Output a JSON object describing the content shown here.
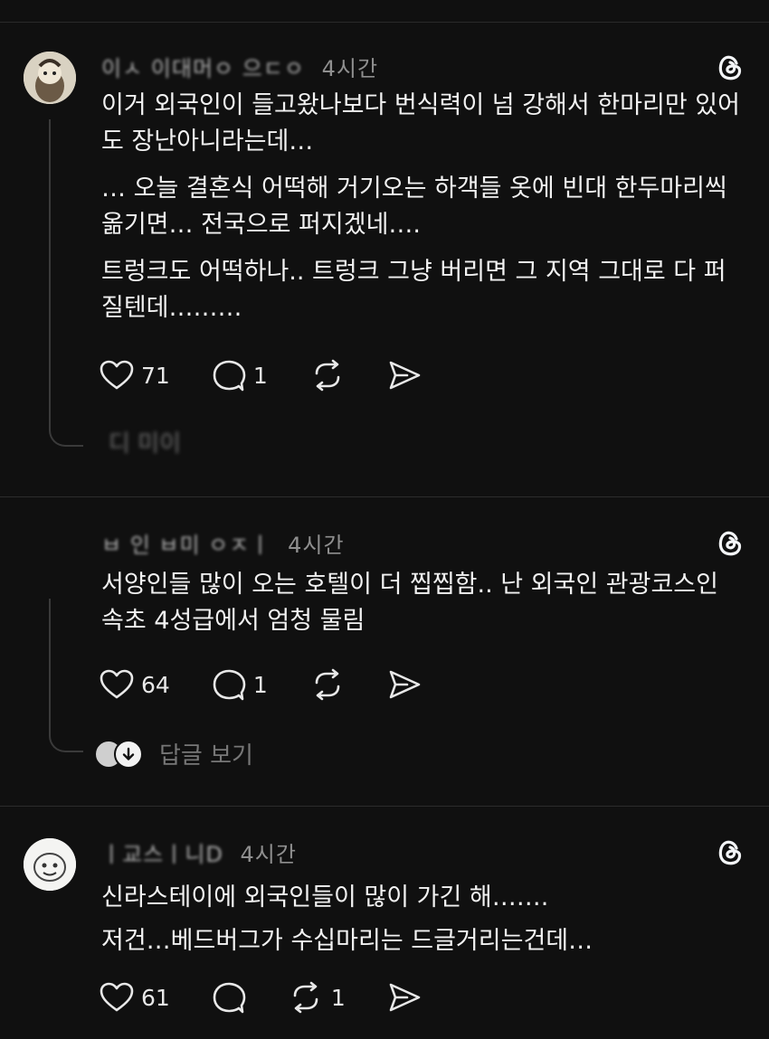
{
  "posts": [
    {
      "handle": "이ㅅ 이대머ㅇ 으ㄷㅇ",
      "time": "4시간",
      "paragraphs": [
        "이거 외국인이 들고왔나보다 번식력이 넘 강해서 한마리만 있어도 장난아니라는데…",
        "… 오늘 결혼식 어떡해 거기오는 하객들 옷에 빈대 한두마리씩 옮기면… 전국으로 퍼지겠네….",
        "트렁크도 어떡하나.. 트렁크 그냥 버리면 그 지역 그대로 다 퍼질텐데………"
      ],
      "likes": "71",
      "comments": "1",
      "reposts": "",
      "replies_label": "디 미이"
    },
    {
      "handle": "ㅂ 인 ㅂ미 ㅇㅈㅣ",
      "time": "4시간",
      "paragraphs": [
        "서양인들 많이 오는 호텔이 더 찝찝함.. 난 외국인 관광코스인 속초 4성급에서 엄청 물림"
      ],
      "likes": "64",
      "comments": "1",
      "reposts": "",
      "replies_label": "답글 보기"
    },
    {
      "handle": "ㅣ교스ㅣ니D",
      "time": "4시간",
      "paragraphs": [
        "신라스테이에 외국인들이 많이 가긴 해…….",
        "저건…베드버그가 수십마리는 드글거리는건데…"
      ],
      "likes": "61",
      "comments": "",
      "reposts": "1"
    }
  ],
  "icons": {
    "like": "heart-icon",
    "comment": "speech-bubble-icon",
    "repost": "repost-icon",
    "share": "send-icon",
    "brand": "threads-logo-icon",
    "expand": "arrow-down-icon"
  },
  "colors": {
    "background": "#101010",
    "text": "#f3f5f7",
    "muted": "#8a8a8a",
    "separator": "#2c2c2c"
  }
}
